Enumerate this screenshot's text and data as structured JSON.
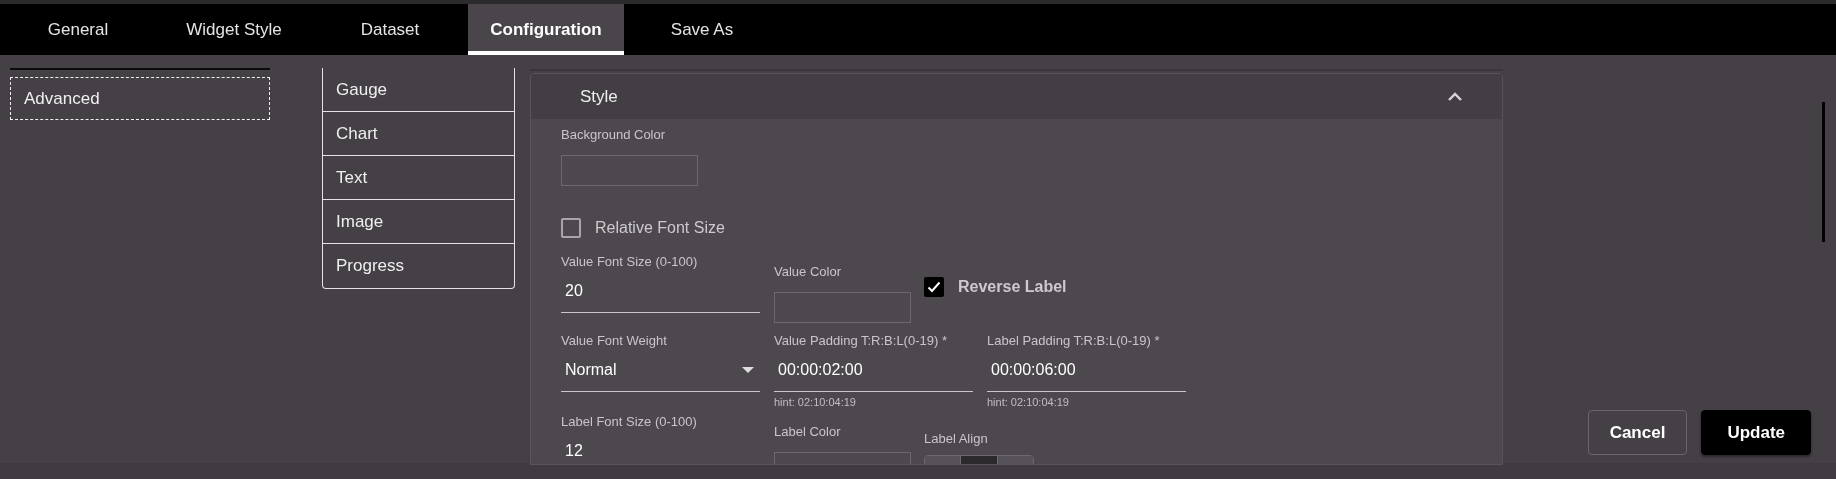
{
  "tabs": [
    {
      "label": "General",
      "selected": false
    },
    {
      "label": "Widget Style",
      "selected": false
    },
    {
      "label": "Dataset",
      "selected": false
    },
    {
      "label": "Configuration",
      "selected": true
    },
    {
      "label": "Save As",
      "selected": false
    }
  ],
  "sidebar": {
    "items": [
      {
        "label": "Advanced"
      }
    ]
  },
  "widget_types": [
    {
      "label": "Gauge"
    },
    {
      "label": "Chart"
    },
    {
      "label": "Text"
    },
    {
      "label": "Image"
    },
    {
      "label": "Progress"
    }
  ],
  "style_section": {
    "title": "Style",
    "expanded": true,
    "rows": [
      [
        {
          "kind": "color",
          "label": "Background Color"
        }
      ],
      [
        {
          "kind": "checkbox",
          "label": "Relative Font Size",
          "checked": false
        }
      ],
      [
        {
          "kind": "text",
          "label": "Value Font Size (0-100)",
          "value": "20"
        },
        {
          "kind": "color",
          "label": "Value Color"
        },
        {
          "kind": "checkbox",
          "label": "Reverse Label",
          "checked": true
        }
      ],
      [
        {
          "kind": "select",
          "label": "Value Font Weight",
          "value": "Normal"
        },
        {
          "kind": "text",
          "label": "Value Padding T:R:B:L(0-19) *",
          "value": "00:00:02:00",
          "hint": "hint: 02:10:04:19"
        },
        {
          "kind": "text",
          "label": "Label Padding T:R:B:L(0-19) *",
          "value": "00:00:06:00",
          "hint": "hint: 02:10:04:19"
        }
      ],
      [
        {
          "kind": "text",
          "label": "Label Font Size (0-100)",
          "value": "12"
        },
        {
          "kind": "color",
          "label": "Label Color"
        },
        {
          "kind": "segmented",
          "label": "Label Align",
          "segments": [
            {
              "selected": false
            },
            {
              "selected": true
            },
            {
              "selected": false
            }
          ]
        }
      ]
    ]
  },
  "buttons": [
    {
      "label": "Cancel",
      "kind": "secondary"
    },
    {
      "label": "Update",
      "kind": "primary"
    }
  ]
}
